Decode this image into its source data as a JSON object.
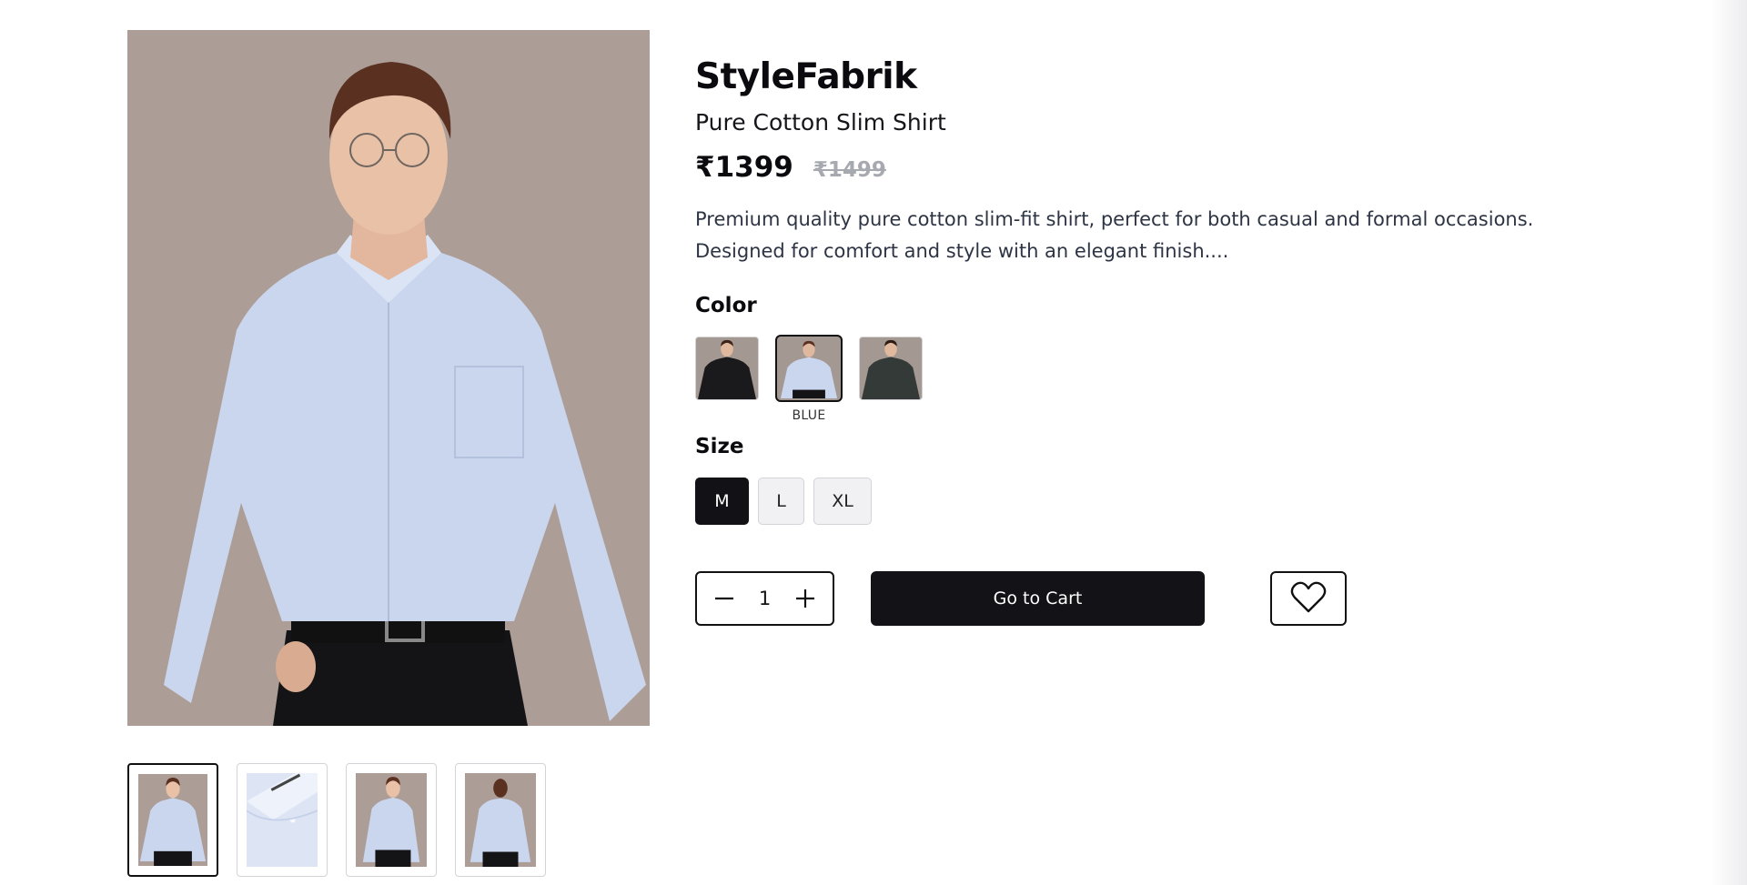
{
  "product": {
    "brand": "StyleFabrik",
    "name": "Pure Cotton Slim Shirt",
    "price": "₹1399",
    "mrp": "₹1499",
    "description": "Premium quality pure cotton slim-fit shirt, perfect for both casual and formal occasions. Designed for comfort and style with an elegant finish...."
  },
  "gallery": {
    "main_image": "model-light-blue-shirt-front",
    "thumbnails": [
      {
        "image": "model-front",
        "active": true
      },
      {
        "image": "folded-shirt-collar",
        "active": false
      },
      {
        "image": "model-angled",
        "active": false
      },
      {
        "image": "model-back",
        "active": false
      }
    ]
  },
  "color": {
    "label": "Color",
    "selected_name": "BLUE",
    "options": [
      {
        "image": "black-shirt-model",
        "selected": false
      },
      {
        "image": "blue-shirt-model",
        "selected": true
      },
      {
        "image": "dark-grey-shirt-model",
        "selected": false
      }
    ]
  },
  "size": {
    "label": "Size",
    "options": [
      {
        "label": "M",
        "selected": true
      },
      {
        "label": "L",
        "selected": false
      },
      {
        "label": "XL",
        "selected": false
      }
    ]
  },
  "quantity": {
    "value": "1",
    "decrement_icon": "minus-icon",
    "increment_icon": "plus-icon"
  },
  "actions": {
    "cart_label": "Go to Cart",
    "wishlist_icon": "heart-icon"
  },
  "colors": {
    "primary": "#121217",
    "background": "#ffffff",
    "muted_price": "#a7a9b0",
    "shirt_blue": "#c9d6ee",
    "photo_backdrop": "#ad9d97"
  }
}
